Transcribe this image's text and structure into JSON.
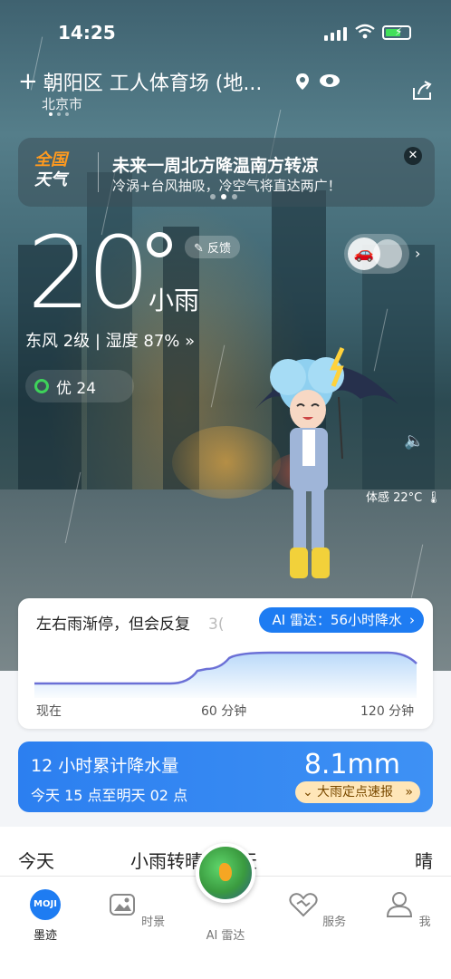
{
  "status_bar": {
    "time": "14:25"
  },
  "header": {
    "location": "朝阳区 工人体育场 (地...",
    "city": "北京市"
  },
  "banner": {
    "logo_line1": "全国",
    "logo_line2": "天气",
    "title": "未来一周北方降温南方转凉",
    "subtitle": "冷涡+台风抽吸，冷空气将直达两广！"
  },
  "current": {
    "temperature": "20",
    "condition": "小雨",
    "feedback": "反馈",
    "wind_humidity": "东风 2级 | 湿度 87% »",
    "aqi": "优 24",
    "feels_like": "体感 22°C"
  },
  "radar": {
    "summary": "左右雨渐停，但会反复",
    "summary_tail": "3(",
    "button": "AI 雷达：56小时降水",
    "axis": [
      "现在",
      "60 分钟",
      "120 分钟"
    ]
  },
  "precip": {
    "title": "12 小时累计降水量",
    "value": "8.1mm",
    "range": "今天 15 点至明天 02 点",
    "alert": "大雨定点速报"
  },
  "forecast": {
    "day": "今天",
    "condition": "小雨转晴",
    "next_day": "明天",
    "next_condition": "晴"
  },
  "tabs": {
    "moji_logo": "MOJI",
    "t1": "墨迹",
    "t2": "时景",
    "t3": "AI 雷达",
    "t4": "服务",
    "t5": "我"
  },
  "colors": {
    "accent": "#1e7cf2",
    "aqi_good": "#3ed35a",
    "alert_bg": "#ffe6b8"
  }
}
